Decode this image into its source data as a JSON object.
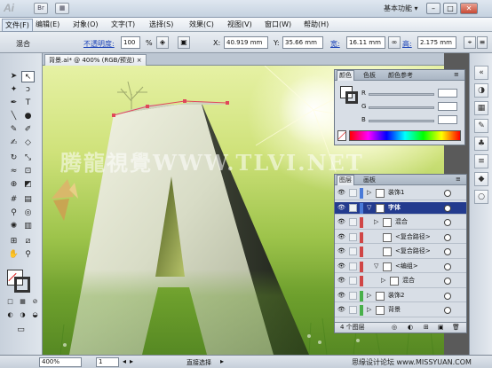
{
  "app": {
    "logo": "Ai",
    "workspace_label": "基本功能",
    "window_buttons": [
      "–",
      "□",
      "✕"
    ]
  },
  "menu": [
    "文件(F)",
    "编辑(E)",
    "对象(O)",
    "文字(T)",
    "选择(S)",
    "效果(C)",
    "视图(V)",
    "窗口(W)",
    "帮助(H)"
  ],
  "control_bar": {
    "mode_label": "混合",
    "opacity_label": "不透明度:",
    "opacity_value": "100",
    "percent": "%",
    "x_label": "X:",
    "x_value": "40.919 mm",
    "y_label": "Y:",
    "y_value": "35.66 mm",
    "w_label": "宽:",
    "w_value": "16.11 mm",
    "h_label": "高:",
    "h_value": "2.175 mm"
  },
  "document_tab": {
    "title": "背景.ai* @ 400% (RGB/预览)",
    "close": "×"
  },
  "canvas": {
    "watermark": "腾龍視覺WWW.TLVI.NET"
  },
  "color_panel": {
    "tabs": [
      "颜色",
      "色板",
      "颜色参考"
    ],
    "sliders": [
      "R",
      "G",
      "B"
    ]
  },
  "layers_panel": {
    "tabs": [
      "图层",
      "画板"
    ],
    "rows": [
      {
        "name": "装饰1",
        "indent": 0,
        "color": "#4a7ad8",
        "visible": true,
        "expand": "▷"
      },
      {
        "name": "字体",
        "indent": 0,
        "color": "#4a7ad8",
        "visible": true,
        "expand": "▽",
        "selected": true
      },
      {
        "name": "混合",
        "indent": 1,
        "color": "#d04646",
        "visible": true,
        "expand": "▷"
      },
      {
        "name": "<复合路径>",
        "indent": 1,
        "color": "#d04646",
        "visible": true,
        "expand": ""
      },
      {
        "name": "<复合路径>",
        "indent": 1,
        "color": "#d04646",
        "visible": true,
        "expand": ""
      },
      {
        "name": "<编组>",
        "indent": 1,
        "color": "#d04646",
        "visible": true,
        "expand": "▽"
      },
      {
        "name": "混合",
        "indent": 2,
        "color": "#d04646",
        "visible": true,
        "expand": "▷"
      },
      {
        "name": "装饰2",
        "indent": 0,
        "color": "#49b04a",
        "visible": true,
        "expand": "▷"
      },
      {
        "name": "背景",
        "indent": 0,
        "color": "#49b04a",
        "visible": true,
        "expand": "▷"
      }
    ],
    "footer_label": "4 个图层"
  },
  "status_bar": {
    "zoom": "400%",
    "page": "1",
    "tool_label": "直接选择"
  },
  "footer_watermark": "思缘设计论坛 www.MISSYUAN.COM",
  "colors": {
    "selection_blue": "#233b8e",
    "menu_accent": "#1a43b8",
    "path_red": "#e0475a"
  }
}
